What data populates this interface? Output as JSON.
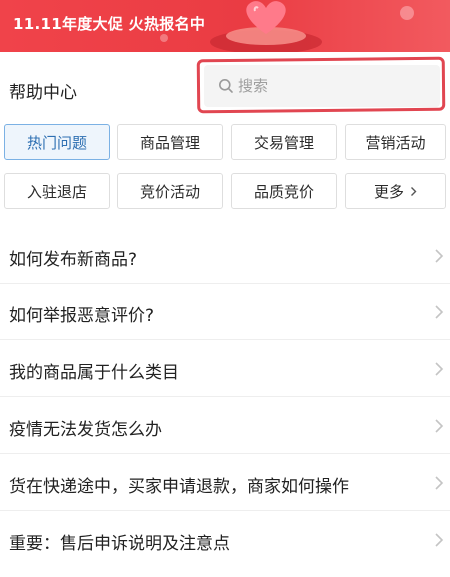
{
  "banner": {
    "text": "11.11年度大促 火热报名中"
  },
  "header": {
    "title": "帮助中心"
  },
  "search": {
    "placeholder": "搜索",
    "value": ""
  },
  "categories": [
    {
      "label": "热门问题",
      "active": true
    },
    {
      "label": "商品管理",
      "active": false
    },
    {
      "label": "交易管理",
      "active": false
    },
    {
      "label": "营销活动",
      "active": false
    },
    {
      "label": "入驻退店",
      "active": false
    },
    {
      "label": "竞价活动",
      "active": false
    },
    {
      "label": "品质竞价",
      "active": false
    },
    {
      "label": "更多",
      "active": false
    }
  ],
  "questions": [
    {
      "label": "如何发布新商品?"
    },
    {
      "label": "如何举报恶意评价?"
    },
    {
      "label": "我的商品属于什么类目"
    },
    {
      "label": "疫情无法发货怎么办"
    },
    {
      "label": "货在快递途中，买家申请退款，商家如何操作"
    },
    {
      "label": "重要：售后申诉说明及注意点"
    }
  ],
  "icons": {
    "search": "search-icon",
    "chevron": "chevron-right-icon"
  },
  "colors": {
    "banner": "#ea3c43",
    "active_tab_text": "#2d6fb2",
    "active_tab_border": "#7bb1e4",
    "search_highlight": "#e14651"
  }
}
